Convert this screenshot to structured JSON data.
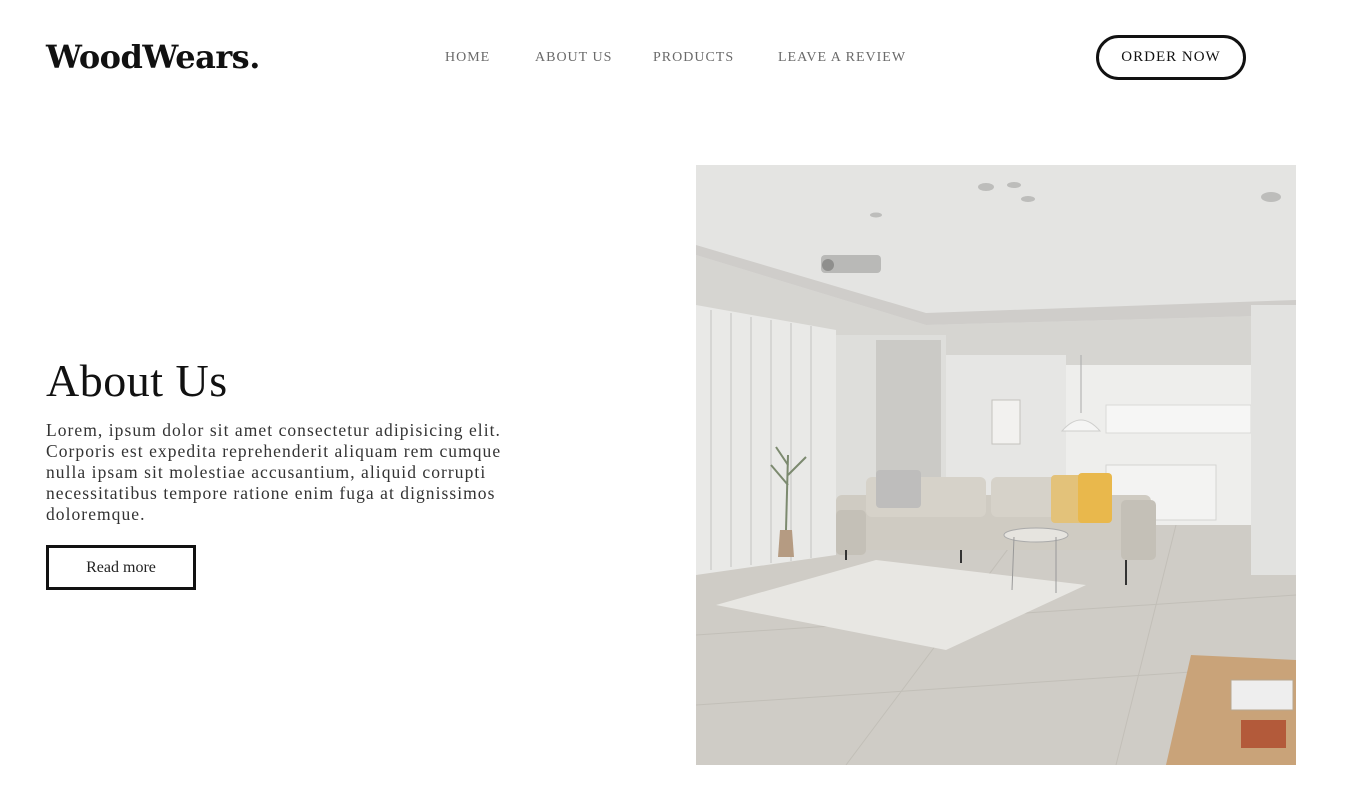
{
  "brand": {
    "logo_text": "WoodWears."
  },
  "nav": {
    "items": [
      {
        "label": "HOME"
      },
      {
        "label": "ABOUT US"
      },
      {
        "label": "PRODUCTS"
      },
      {
        "label": "LEAVE A REVIEW"
      }
    ]
  },
  "header": {
    "cta_label": "ORDER NOW"
  },
  "about": {
    "title": "About Us",
    "body": "Lorem, ipsum dolor sit amet consectetur adipisicing elit. Corporis est expedita reprehenderit aliquam rem cumque nulla ipsam sit molestiae accusantium, aliquid corrupti necessitatibus tempore ratione enim fuga at dignissimos doloremque.",
    "button_label": "Read more"
  },
  "colors": {
    "text_primary": "#111111",
    "nav_text": "#6a6a6a",
    "background": "#ffffff"
  }
}
